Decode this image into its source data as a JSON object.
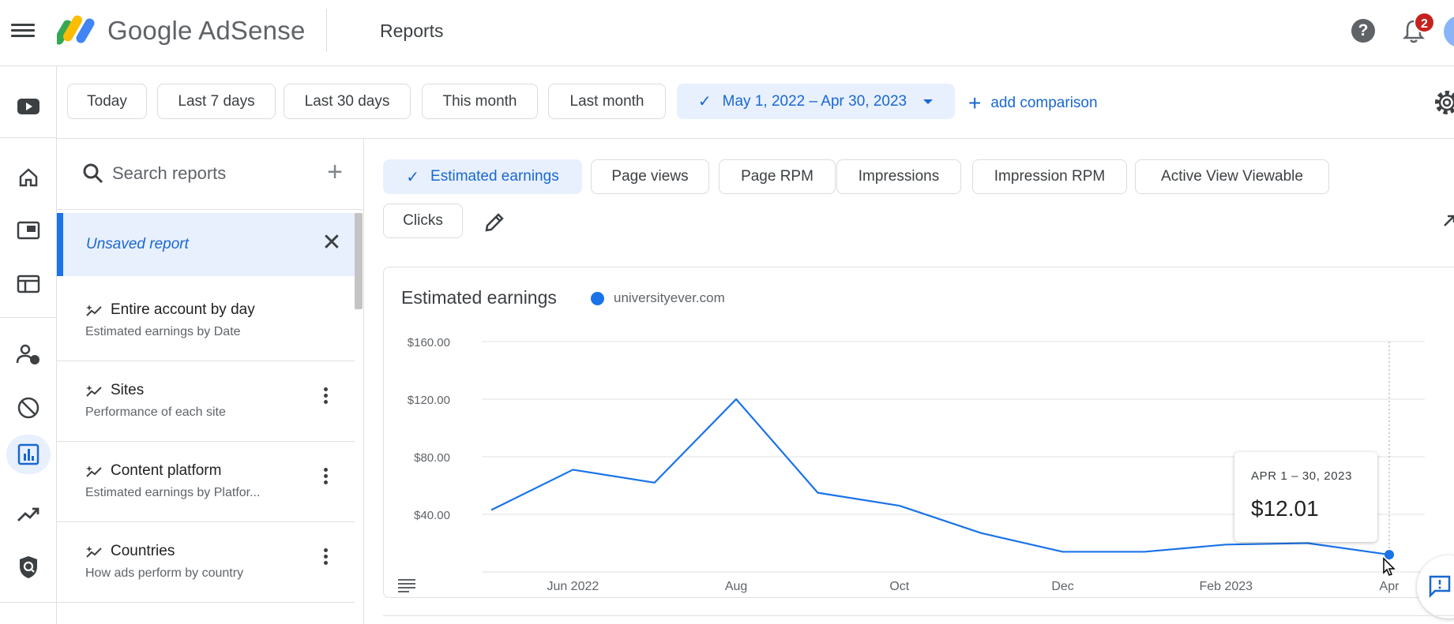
{
  "header": {
    "brand": "Google AdSense",
    "page_title": "Reports",
    "notification_count": "2"
  },
  "rail": {
    "items": [
      "youtube-icon",
      "home-icon",
      "ads-icon",
      "sites-icon",
      "privacy-icon",
      "blocking-icon",
      "reports-icon",
      "optimization-icon",
      "policy-icon"
    ],
    "active": "reports-icon"
  },
  "date_filters": {
    "options": [
      "Today",
      "Last 7 days",
      "Last 30 days",
      "This month",
      "Last month"
    ],
    "selected_range": "May 1, 2022 – Apr 30, 2023",
    "add_comparison": "add comparison"
  },
  "reports_panel": {
    "search_placeholder": "Search reports",
    "unsaved_report": "Unsaved report",
    "items": [
      {
        "title": "Entire account by day",
        "subtitle": "Estimated earnings by Date"
      },
      {
        "title": "Sites",
        "subtitle": "Performance of each site"
      },
      {
        "title": "Content platform",
        "subtitle": "Estimated earnings by Platfor..."
      },
      {
        "title": "Countries",
        "subtitle": "How ads perform by country"
      }
    ]
  },
  "metrics": {
    "items": [
      "Estimated earnings",
      "Page views",
      "Page RPM",
      "Impressions",
      "Impression RPM",
      "Active View Viewable",
      "Clicks"
    ],
    "selected": "Estimated earnings"
  },
  "chart_card": {
    "title": "Estimated earnings",
    "legend": "universityever.com",
    "series_color": "#1a73e8"
  },
  "tooltip": {
    "range": "APR 1 – 30, 2023",
    "value": "$12.01"
  },
  "chart_data": {
    "type": "line",
    "title": "Estimated earnings",
    "x": [
      "May 2022",
      "Jun 2022",
      "Jul 2022",
      "Aug 2022",
      "Sep 2022",
      "Oct 2022",
      "Nov 2022",
      "Dec 2022",
      "Jan 2023",
      "Feb 2023",
      "Mar 2023",
      "Apr 2023"
    ],
    "series": [
      {
        "name": "universityever.com",
        "values": [
          43,
          71,
          62,
          120,
          55,
          46,
          27,
          14,
          14,
          19,
          20,
          12.01
        ]
      }
    ],
    "x_tick_labels": [
      "Jun 2022",
      "Aug",
      "Oct",
      "Dec",
      "Feb 2023",
      "Apr"
    ],
    "y_tick_labels": [
      "$40.00",
      "$80.00",
      "$120.00",
      "$160.00"
    ],
    "ylim": [
      0,
      160
    ],
    "grid": true,
    "legend_position": "top-left"
  }
}
